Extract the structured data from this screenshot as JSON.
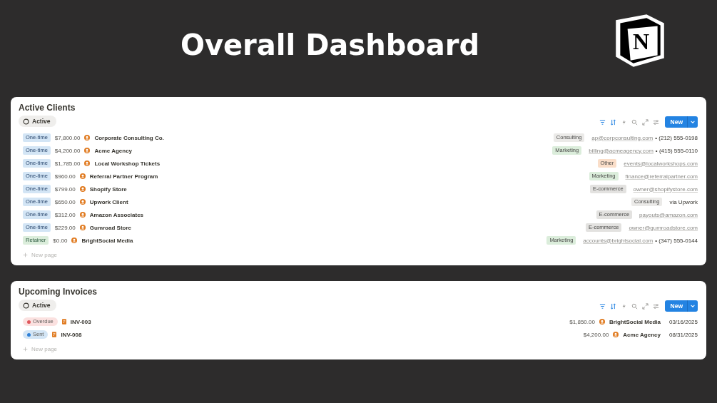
{
  "heading": "Overall Dashboard",
  "logo": {
    "letter": "N"
  },
  "clients": {
    "title": "Active Clients",
    "view": "Active",
    "filter_active": true,
    "sort_active": true,
    "new_button": "New",
    "rows": [
      {
        "type": "One-time",
        "kind": "one_time",
        "amount": "$7,800.00",
        "name": "Corporate Consulting Co.",
        "category": "Consulting",
        "color": "#ebeae8",
        "email": "ap@corpconsulting.com",
        "phone": "• (212) 555-0198"
      },
      {
        "type": "One-time",
        "kind": "one_time",
        "amount": "$4,200.00",
        "name": "Acme Agency",
        "category": "Marketing",
        "color": "#dbeddb",
        "email": "billing@acmeagency.com",
        "phone": "• (415) 555-0110"
      },
      {
        "type": "One-time",
        "kind": "one_time",
        "amount": "$1,785.00",
        "name": "Local Workshop Tickets",
        "category": "Other",
        "color": "#fadec9",
        "email": "events@localworkshops.com"
      },
      {
        "type": "One-time",
        "kind": "one_time",
        "amount": "$960.00",
        "name": "Referral Partner Program",
        "category": "Marketing",
        "color": "#dbeddb",
        "email": "finance@referralpartner.com"
      },
      {
        "type": "One-time",
        "kind": "one_time",
        "amount": "$799.00",
        "name": "Shopify Store",
        "category": "E-commerce",
        "color": "#e3e2e0",
        "email": "owner@shopifystore.com"
      },
      {
        "type": "One-time",
        "kind": "one_time",
        "amount": "$650.00",
        "name": "Upwork Client",
        "category": "Consulting",
        "color": "#ebeae8",
        "note": "via Upwork"
      },
      {
        "type": "One-time",
        "kind": "one_time",
        "amount": "$312.00",
        "name": "Amazon Associates",
        "category": "E-commerce",
        "color": "#e3e2e0",
        "email": "payouts@amazon.com"
      },
      {
        "type": "One-time",
        "kind": "one_time",
        "amount": "$229.00",
        "name": "Gumroad Store",
        "category": "E-commerce",
        "color": "#e3e2e0",
        "email": "owner@gumroadstore.com"
      },
      {
        "type": "Retainer",
        "kind": "retainer",
        "amount": "$0.00",
        "name": "BrightSocial Media",
        "category": "Marketing",
        "color": "#dbeddb",
        "email": "accounts@brightsocial.com",
        "phone": "• (347) 555-0144"
      }
    ],
    "new_page": "New page"
  },
  "invoices": {
    "title": "Upcoming Invoices",
    "view": "Active",
    "filter_active": true,
    "sort_active": true,
    "new_button": "New",
    "rows": [
      {
        "status": "Overdue",
        "kind": "overdue",
        "color": "#e0565b",
        "number": "INV-003",
        "amount": "$1,850.00",
        "client": "BrightSocial Media",
        "date": "03/16/2025"
      },
      {
        "status": "Sent",
        "kind": "sent",
        "color": "#2f80d7",
        "number": "INV-008",
        "amount": "$4,200.00",
        "client": "Acme Agency",
        "date": "08/31/2025"
      }
    ],
    "new_page": "New page"
  }
}
